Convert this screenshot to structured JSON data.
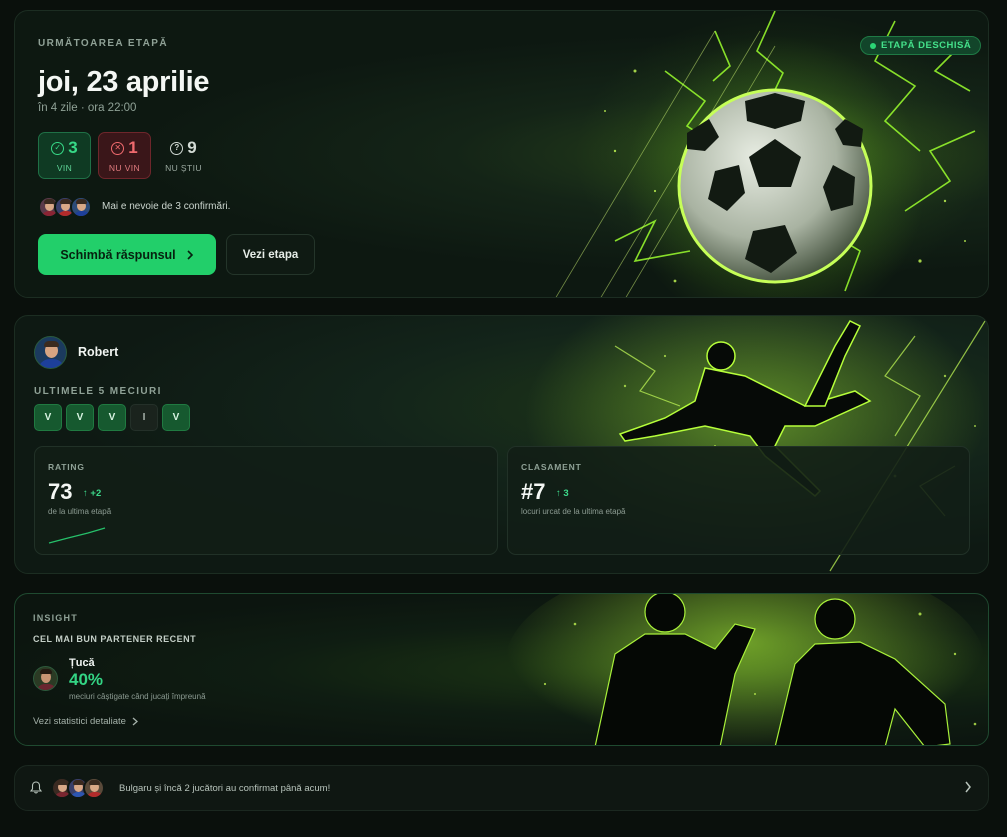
{
  "next_round": {
    "overline": "URMĂTOAREA ETAPĂ",
    "date": "joi, 23 aprilie",
    "subtitle": "în 4 zile · ora 22:00",
    "status_badge": "ETAPĂ DESCHISĂ",
    "stats": {
      "vin": {
        "value": "3",
        "label": "VIN"
      },
      "nu_vin": {
        "value": "1",
        "label": "NU VIN"
      },
      "nu_stiu": {
        "value": "9",
        "label": "NU ȘTIU"
      }
    },
    "confirm_text": "Mai e nevoie de 3 confirmări.",
    "change_button": "Schimbă răspunsul",
    "view_button": "Vezi etapa"
  },
  "player": {
    "name": "Robert",
    "form_overline": "ULTIMELE 5 MECIURI",
    "form": [
      "V",
      "V",
      "V",
      "I",
      "V"
    ],
    "rating": {
      "overline": "RATING",
      "value": "73",
      "delta": "+2",
      "note": "de la ultima etapă"
    },
    "rank": {
      "overline": "CLASAMENT",
      "value": "#7",
      "delta": "3",
      "note": "locuri urcat de la ultima etapă"
    }
  },
  "insight": {
    "overline": "INSIGHT",
    "heading": "CEL MAI BUN PARTENER RECENT",
    "partner_name": "Țucă",
    "partner_pct": "40%",
    "partner_note": "meciuri câștigate când jucați împreună",
    "link": "Vezi statistici detaliate"
  },
  "notification": {
    "text": "Bulgaru și încă 2 jucători au confirmat până acum!"
  },
  "colors": {
    "accent": "#22cf6a",
    "win_bg": "#0f3a23",
    "loss_bg": "#3a1619",
    "neon": "#b6ff3a"
  }
}
